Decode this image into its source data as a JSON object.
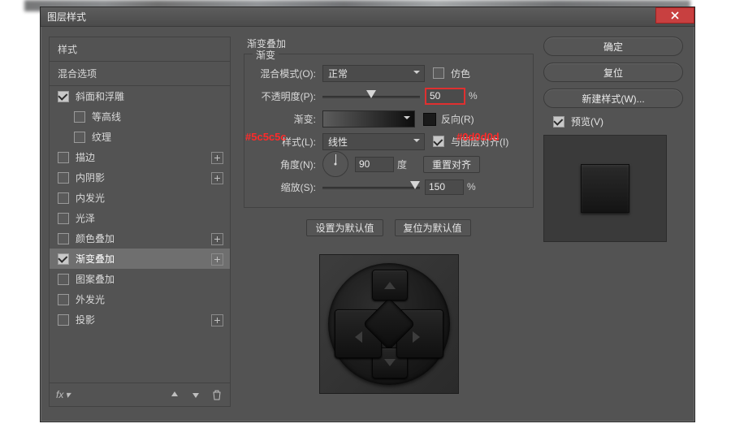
{
  "window": {
    "title": "图层样式"
  },
  "annotations": {
    "grad_start": "#5c5c5c",
    "grad_end": "#0d0d0d"
  },
  "left": {
    "headings": {
      "styles": "样式",
      "blend_options": "混合选项"
    },
    "items": [
      {
        "label": "斜面和浮雕",
        "checked": true,
        "plus": false,
        "indent": false
      },
      {
        "label": "等高线",
        "checked": false,
        "plus": false,
        "indent": true
      },
      {
        "label": "纹理",
        "checked": false,
        "plus": false,
        "indent": true
      },
      {
        "label": "描边",
        "checked": false,
        "plus": true,
        "indent": false
      },
      {
        "label": "内阴影",
        "checked": false,
        "plus": true,
        "indent": false
      },
      {
        "label": "内发光",
        "checked": false,
        "plus": false,
        "indent": false
      },
      {
        "label": "光泽",
        "checked": false,
        "plus": false,
        "indent": false
      },
      {
        "label": "颜色叠加",
        "checked": false,
        "plus": true,
        "indent": false
      },
      {
        "label": "渐变叠加",
        "checked": true,
        "plus": true,
        "indent": false,
        "selected": true
      },
      {
        "label": "图案叠加",
        "checked": false,
        "plus": false,
        "indent": false
      },
      {
        "label": "外发光",
        "checked": false,
        "plus": false,
        "indent": false
      },
      {
        "label": "投影",
        "checked": false,
        "plus": true,
        "indent": false
      }
    ],
    "footer_fx": "fx"
  },
  "mid": {
    "section_title": "渐变叠加",
    "group_legend": "渐变",
    "labels": {
      "blend_mode": "混合模式(O):",
      "opacity": "不透明度(P):",
      "gradient": "渐变:",
      "style": "样式(L):",
      "angle": "角度(N):",
      "scale": "缩放(S):"
    },
    "blend_mode_value": "正常",
    "dither_label": "仿色",
    "opacity_value": "50",
    "opacity_unit": "%",
    "reverse_label": "反向(R)",
    "style_value": "线性",
    "align_label": "与图层对齐(I)",
    "angle_value": "90",
    "angle_unit": "度",
    "reset_align_btn": "重置对齐",
    "scale_value": "150",
    "scale_unit": "%",
    "set_default_btn": "设置为默认值",
    "reset_default_btn": "复位为默认值"
  },
  "right": {
    "ok": "确定",
    "reset": "复位",
    "new_style": "新建样式(W)...",
    "preview_label": "预览(V)"
  }
}
